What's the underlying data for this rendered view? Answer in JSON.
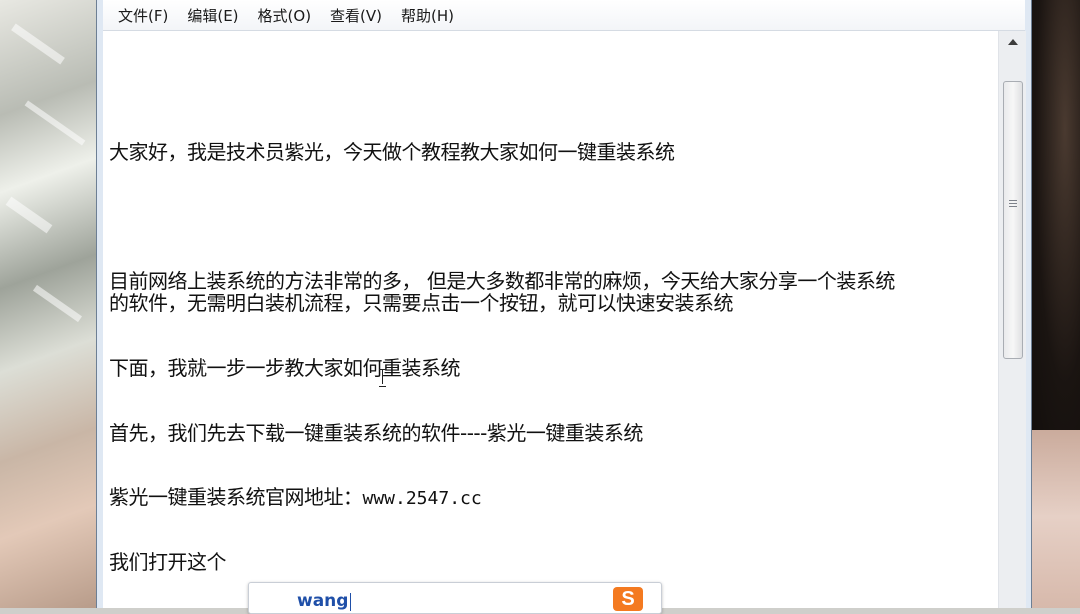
{
  "app": {
    "menus": [
      {
        "label": "文件(F)"
      },
      {
        "label": "编辑(E)"
      },
      {
        "label": "格式(O)"
      },
      {
        "label": "查看(V)"
      },
      {
        "label": "帮助(H)"
      }
    ]
  },
  "document": {
    "lines": [
      "大家好，我是技术员紫光，今天做个教程教大家如何一键重装系统",
      "目前网络上装系统的方法非常的多，  但是大多数都非常的麻烦，今天给大家分享一个装系统",
      "的软件，无需明白装机流程，只需要点击一个按钮，就可以快速安装系统",
      "下面，我就一步一步教大家如何重装系统",
      "首先，我们先去下载一键重装系统的软件----紫光一键重装系统",
      "紫光一键重装系统官网地址：",
      "www.2547.cc",
      "我们打开这个"
    ]
  },
  "ime": {
    "composition": "wang",
    "logo": "S",
    "logo_color": "#f47a20"
  },
  "icons": [
    "scroll-up-arrow-icon",
    "scroll-thumb-grip-icon",
    "text-cursor-icon",
    "sogou-ime-logo-icon"
  ]
}
